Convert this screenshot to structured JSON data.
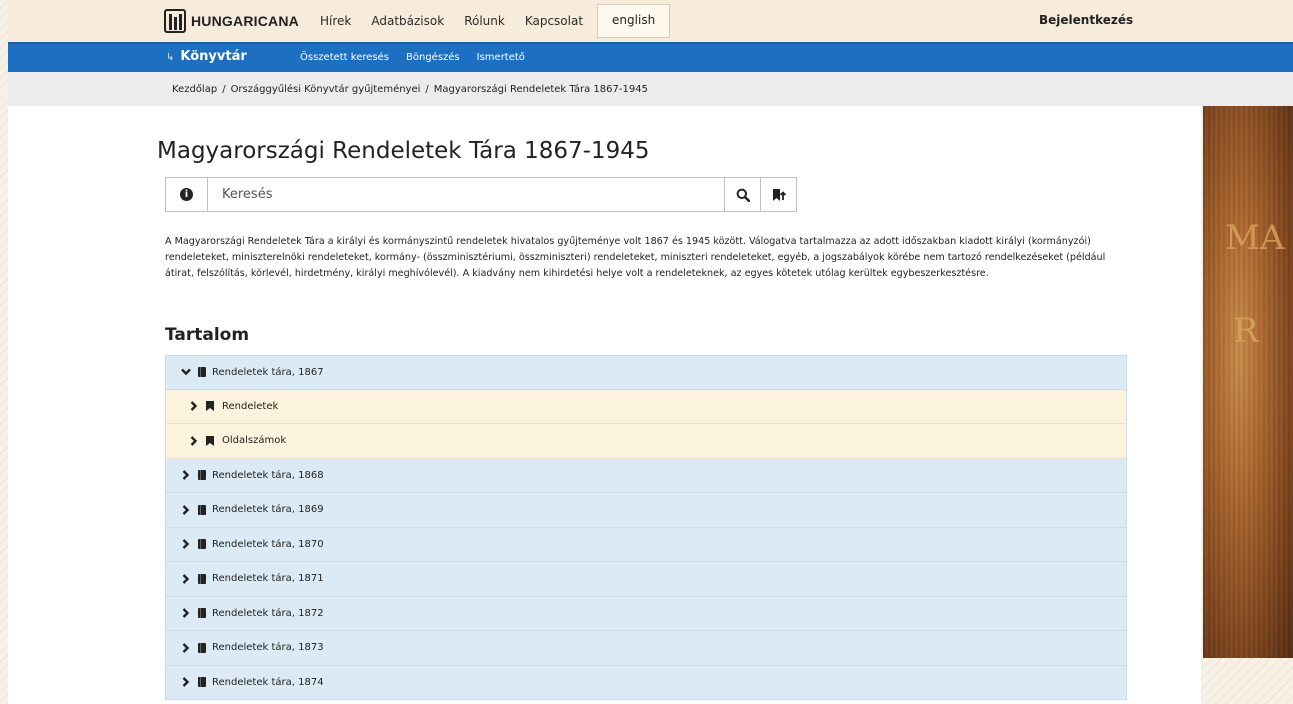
{
  "header": {
    "logo_text": "HUNGARICANA",
    "nav": [
      "Hírek",
      "Adatbázisok",
      "Rólunk",
      "Kapcsolat"
    ],
    "language_button": "english",
    "login_label": "Bejelentkezés"
  },
  "subnav": {
    "library_label": "Könyvtár",
    "arrow": "↳",
    "items": [
      "Összetett keresés",
      "Böngészés",
      "Ismertető"
    ]
  },
  "breadcrumb": [
    "Kezdőlap",
    "Országgyűlési Könyvtár gyűjteményei",
    "Magyarországi Rendeletek Tára 1867-1945"
  ],
  "breadcrumb_separator": "/",
  "page": {
    "title": "Magyarországi Rendeletek Tára 1867-1945",
    "search_placeholder": "Keresés",
    "description": "A Magyarországi Rendeletek Tára a királyi és kormányszintű rendeletek hivatalos gyűjteménye volt 1867 és 1945 között. Válogatva tartalmazza az adott időszakban kiadott királyi (kormányzói) rendeleteket, miniszterelnöki rendeleteket, kormány- (összminisztériumi, összminiszteri) rendeleteket, miniszteri rendeleteket, egyéb, a jogszabályok körébe nem tartozó rendelkezéseket (például átirat, felszólítás, körlevél, hirdetmény, királyi meghívólevél). A kiadvány nem kihirdetési helye volt a rendeleteknek, az egyes kötetek utólag kerültek egybeszerkesztésre.",
    "section_title": "Tartalom"
  },
  "tree": {
    "expanded": {
      "label": "Rendeletek tára, 1867",
      "icon": "book-icon",
      "state": "expanded"
    },
    "children": [
      {
        "label": "Rendeletek",
        "icon": "bookmark-icon"
      },
      {
        "label": "Oldalszámok",
        "icon": "bookmark-icon"
      }
    ],
    "collapsed": [
      "Rendeletek tára, 1868",
      "Rendeletek tára, 1869",
      "Rendeletek tára, 1870",
      "Rendeletek tára, 1871",
      "Rendeletek tára, 1872",
      "Rendeletek tára, 1873",
      "Rendeletek tára, 1874"
    ]
  },
  "colors": {
    "brand_blue": "#1d6fc2",
    "top_bar": "#f7ecdb",
    "tree_row": "#dbeaf4",
    "tree_subrow": "#fbf3de"
  }
}
